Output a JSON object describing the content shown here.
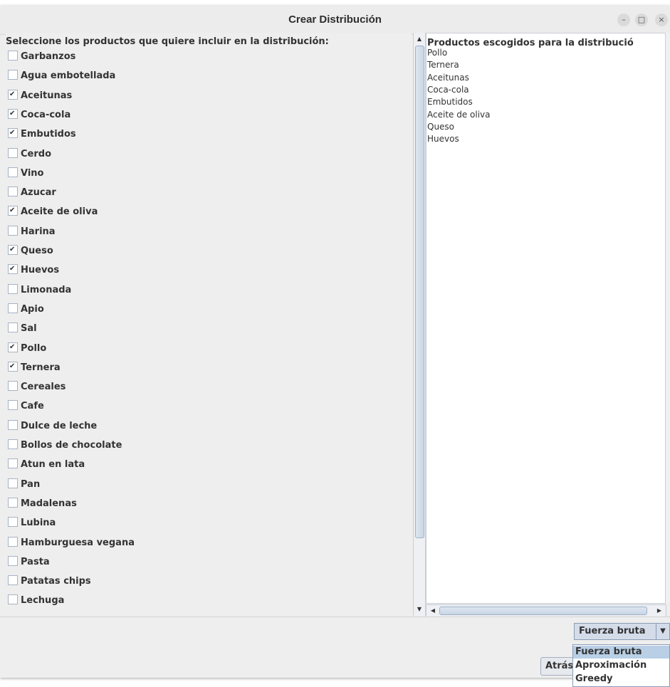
{
  "window": {
    "title": "Crear Distribución",
    "controls": [
      {
        "name": "minimize",
        "glyph": "–"
      },
      {
        "name": "maximize",
        "glyph": "□"
      },
      {
        "name": "close",
        "glyph": "×"
      }
    ]
  },
  "left_panel": {
    "header": "Seleccione los productos que quiere incluir en la distribución:",
    "products": [
      {
        "label": "Garbanzos",
        "checked": false
      },
      {
        "label": "Agua embotellada",
        "checked": false
      },
      {
        "label": "Aceitunas",
        "checked": true
      },
      {
        "label": "Coca-cola",
        "checked": true
      },
      {
        "label": "Embutidos",
        "checked": true
      },
      {
        "label": "Cerdo",
        "checked": false
      },
      {
        "label": "Vino",
        "checked": false
      },
      {
        "label": "Azucar",
        "checked": false
      },
      {
        "label": "Aceite de oliva",
        "checked": true
      },
      {
        "label": "Harina",
        "checked": false
      },
      {
        "label": "Queso",
        "checked": true
      },
      {
        "label": "Huevos",
        "checked": true
      },
      {
        "label": "Limonada",
        "checked": false
      },
      {
        "label": "Apio",
        "checked": false
      },
      {
        "label": "Sal",
        "checked": false
      },
      {
        "label": "Pollo",
        "checked": true
      },
      {
        "label": "Ternera",
        "checked": true
      },
      {
        "label": "Cereales",
        "checked": false
      },
      {
        "label": "Cafe",
        "checked": false
      },
      {
        "label": "Dulce de leche",
        "checked": false
      },
      {
        "label": "Bollos de chocolate",
        "checked": false
      },
      {
        "label": "Atun en lata",
        "checked": false
      },
      {
        "label": "Pan",
        "checked": false
      },
      {
        "label": "Madalenas",
        "checked": false
      },
      {
        "label": "Lubina",
        "checked": false
      },
      {
        "label": "Hamburguesa vegana",
        "checked": false
      },
      {
        "label": "Pasta",
        "checked": false
      },
      {
        "label": "Patatas chips",
        "checked": false
      },
      {
        "label": "Lechuga",
        "checked": false
      }
    ]
  },
  "right_panel": {
    "header": "Productos escogidos para la distribució",
    "items": [
      "Pollo",
      "Ternera",
      "Aceitunas",
      "Coca-cola",
      "Embutidos",
      "Aceite de oliva",
      "Queso",
      "Huevos"
    ]
  },
  "algorithm_select": {
    "selected": "Fuerza bruta",
    "options": [
      "Fuerza bruta",
      "Aproximación",
      "Greedy"
    ]
  },
  "back_button": {
    "label": "Atrás"
  },
  "colors": {
    "window_bg": "#eeeeee",
    "list_bg": "#ffffff",
    "selected_option": "#b8cfe5",
    "combo_bg": "#d4dcea"
  }
}
